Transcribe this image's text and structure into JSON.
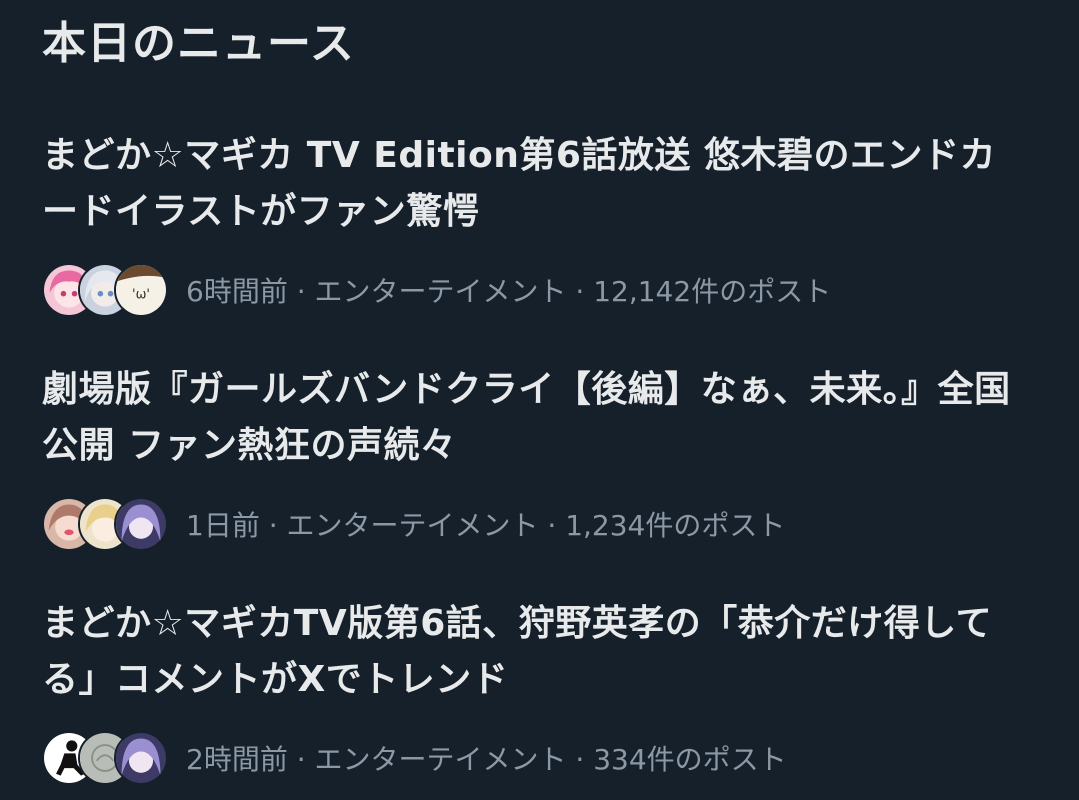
{
  "section": {
    "title": "本日のニュース"
  },
  "items": [
    {
      "headline": "まどか☆マギカ TV Edition第6話放送 悠木碧のエンドカードイラストがファン驚愕",
      "meta": "6時間前 · エンターテイメント · 12,142件のポスト",
      "avatars": [
        "anime-pink-hair-avatar",
        "anime-silver-hair-avatar",
        "face-emoticon-avatar"
      ]
    },
    {
      "headline": "劇場版『ガールズバンドクライ【後編】なぁ、未来。』全国公開 ファン熱狂の声続々",
      "meta": "1日前 · エンターテイメント · 1,234件のポスト",
      "avatars": [
        "anime-brown-hair-avatar",
        "anime-blonde-avatar",
        "anime-purple-hair-avatar"
      ]
    },
    {
      "headline": "まどか☆マギカTV版第6話、狩野英孝の「恭介だけ得してる」コメントがXでトレンド",
      "meta": "2時間前 · エンターテイメント · 334件のポスト",
      "avatars": [
        "sitting-figure-avatar",
        "grey-sketch-avatar",
        "anime-purple-hair-avatar"
      ]
    }
  ]
}
